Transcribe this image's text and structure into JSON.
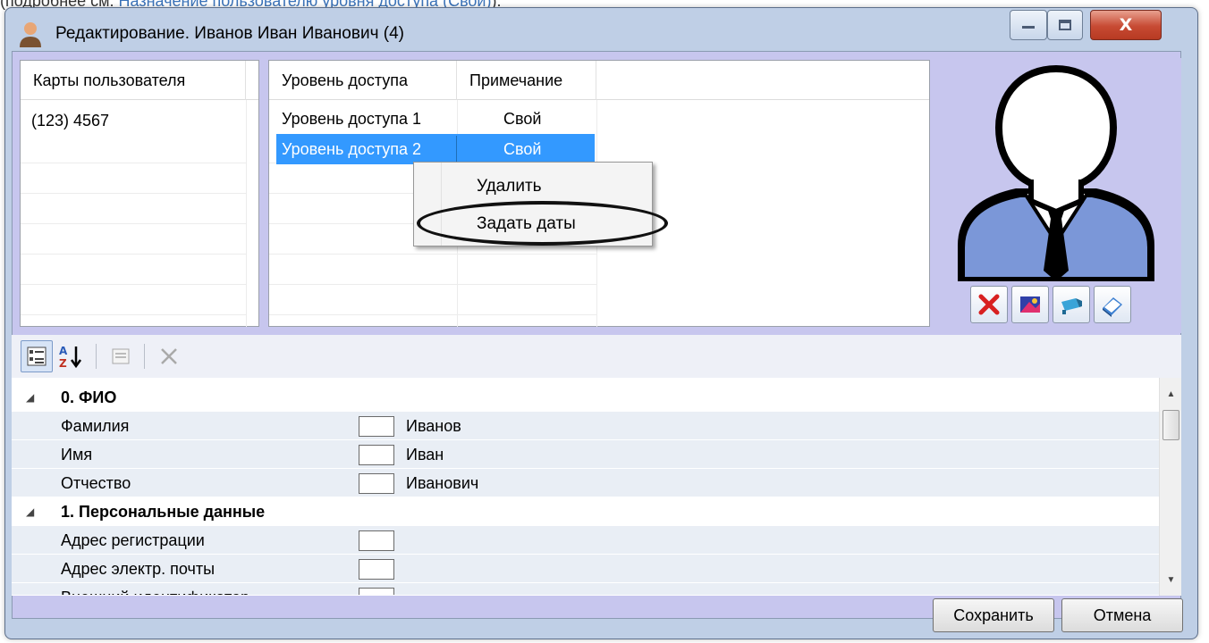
{
  "page": {
    "caption_text": "(подробнее см. ",
    "caption_link": "Назначение пользователю уровня доступа (Свой)",
    "caption_end": ")."
  },
  "window": {
    "title": "Редактирование. Иванов Иван Иванович (4)",
    "close_glyph": "X"
  },
  "cards_panel": {
    "header": "Карты пользователя",
    "rows": [
      "(123) 4567"
    ]
  },
  "access_panel": {
    "headers": [
      "Уровень доступа",
      "Примечание"
    ],
    "rows": [
      {
        "level": "Уровень доступа 1",
        "note": "Свой",
        "selected": false
      },
      {
        "level": "Уровень доступа 2",
        "note": "Свой",
        "selected": true
      }
    ]
  },
  "context_menu": {
    "items": [
      "Удалить",
      "Задать даты"
    ]
  },
  "photo_toolbar": {
    "buttons": [
      "delete-photo-icon",
      "image-icon",
      "webcam-icon",
      "scanner-icon"
    ]
  },
  "prop_toolbar": {
    "buttons": [
      "categorized-view-icon",
      "sort-alpha-icon",
      "property-pages-icon",
      "delete-icon"
    ]
  },
  "properties": {
    "categories": [
      {
        "label": "0. ФИО",
        "items": [
          {
            "name": "Фамилия",
            "value": "Иванов"
          },
          {
            "name": "Имя",
            "value": "Иван"
          },
          {
            "name": "Отчество",
            "value": "Иванович"
          }
        ]
      },
      {
        "label": "1. Персональные данные",
        "items": [
          {
            "name": "Адрес регистрации",
            "value": ""
          },
          {
            "name": "Адрес электр. почты",
            "value": ""
          },
          {
            "name": "Внешний идентификатор",
            "value": ""
          }
        ]
      }
    ]
  },
  "buttons": {
    "save": "Сохранить",
    "cancel": "Отмена"
  },
  "colors": {
    "client_bg": "#c7c6ee",
    "selection": "#3399ff",
    "close_button": "#c74a33",
    "avatar_shirt": "#7b97d8"
  }
}
